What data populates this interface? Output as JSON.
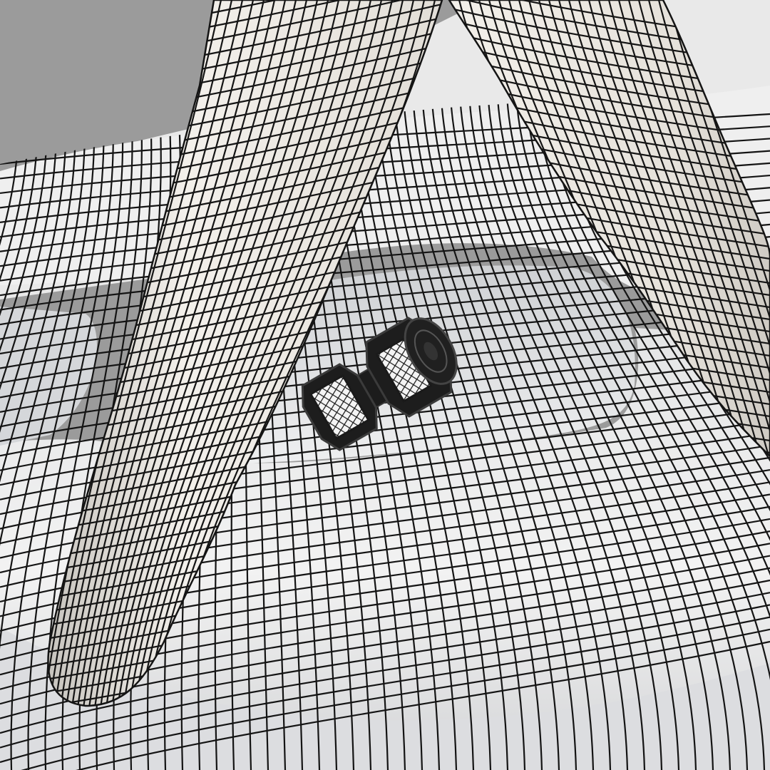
{
  "scene": {
    "subject": "wireframe-render",
    "colors": {
      "background": "#9b9b9b",
      "surface_light": "#eeeeec",
      "surface_mid": "#d9d9d8",
      "surface_shadow": "#b6b8bb",
      "leg_light": "#f1eee9",
      "leg_shadow": "#c9c6c0",
      "wire": "#141414",
      "bolt": "#1c1c1c",
      "bolt_edge": "#3a3a3a"
    },
    "icons": {
      "bolt": "hex-bolt-icon"
    }
  }
}
